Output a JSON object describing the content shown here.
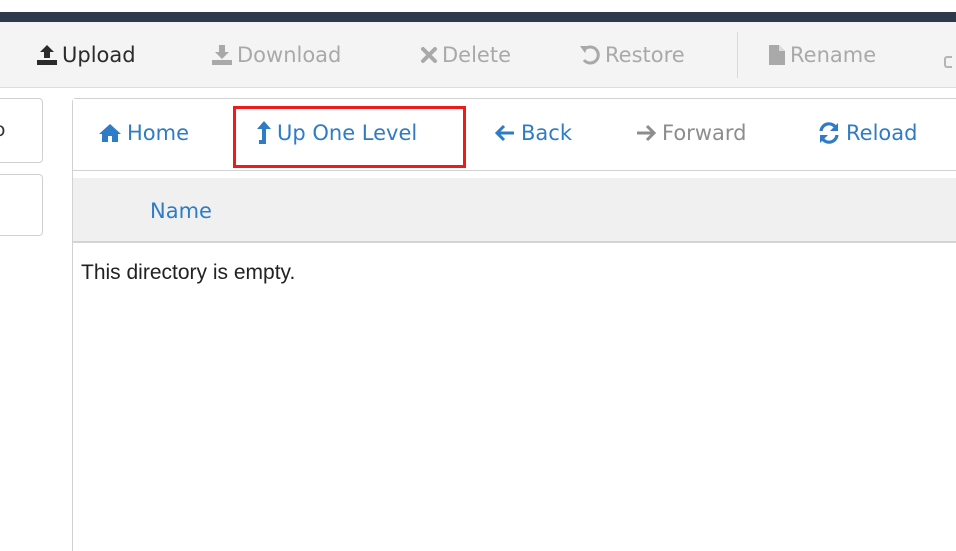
{
  "toolbar": {
    "upload": {
      "label": "Upload",
      "icon": "upload-icon"
    },
    "download": {
      "label": "Download",
      "icon": "download-icon"
    },
    "delete": {
      "label": "Delete",
      "icon": "delete-icon"
    },
    "restore": {
      "label": "Restore",
      "icon": "restore-icon"
    },
    "rename": {
      "label": "Rename",
      "icon": "file-icon"
    }
  },
  "left_panel": {
    "cut_char": "ɔ"
  },
  "nav": {
    "home": {
      "label": "Home",
      "icon": "home-icon"
    },
    "up_one_level": {
      "label": "Up One Level",
      "icon": "arrow-up-icon",
      "highlighted": true
    },
    "back": {
      "label": "Back",
      "icon": "arrow-left-icon"
    },
    "forward": {
      "label": "Forward",
      "icon": "arrow-right-icon"
    },
    "reload": {
      "label": "Reload",
      "icon": "reload-icon"
    }
  },
  "file_list": {
    "columns": [
      "Name"
    ],
    "empty_message": "This directory is empty."
  },
  "colors": {
    "link": "#2f7cc6",
    "highlight_border": "#ef1b1b",
    "topbar": "#2c3a4c",
    "toolbar_bg": "#f4f4f4",
    "disabled_text": "#a9a9a9"
  }
}
